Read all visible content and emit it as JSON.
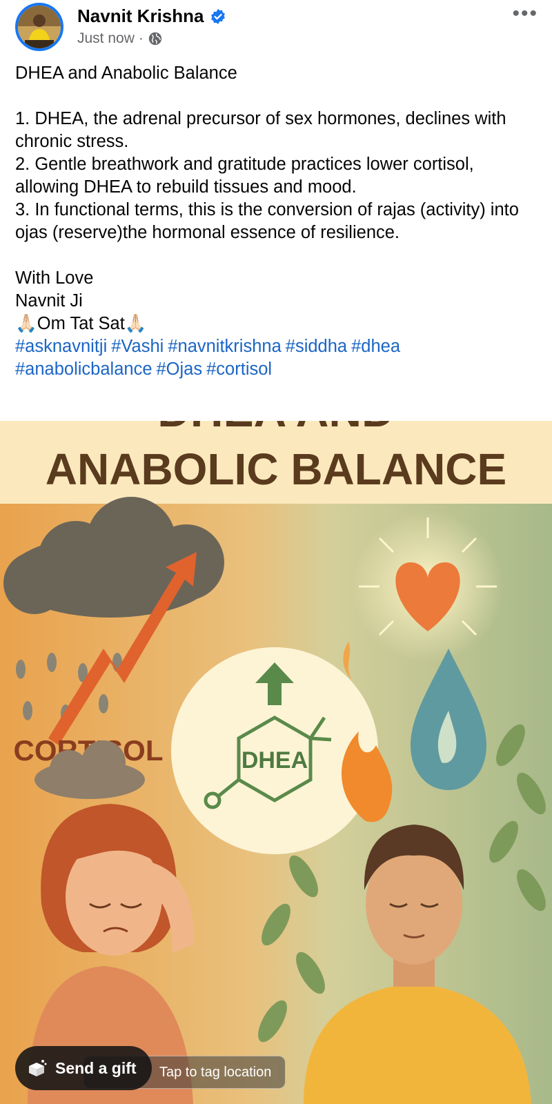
{
  "post": {
    "author": "Navnit Krishna",
    "timestamp": "Just now",
    "separator": "·",
    "privacy_icon": "globe-icon",
    "more_label": "•••",
    "lines": [
      "DHEA and Anabolic Balance",
      "",
      "1. DHEA, the adrenal precursor of sex hormones, declines with chronic stress.",
      "2. Gentle breathwork and gratitude practices lower cortisol, allowing DHEA to rebuild tissues and mood.",
      "3. In functional terms, this is the conversion of rajas (activity) into ojas (reserve)the hormonal essence of resilience.",
      "",
      "With Love",
      "Navnit Ji",
      "🙏🏻Om Tat Sat🙏🏻"
    ],
    "hashtags": [
      "#asknavnitji",
      "#Vashi",
      "#navnitkrishna",
      "#siddha",
      "#dhea",
      "#anabolicbalance",
      "#Ojas",
      "#cortisol"
    ]
  },
  "image": {
    "title_partial": "DHEA AND",
    "title": "ANABOLIC BALANCE",
    "cortisol_label": "CORTISOL",
    "dhea_label": "DHEA"
  },
  "overlay": {
    "gift_label": "Send a gift",
    "tag_label": "Tap to tag location"
  },
  "colors": {
    "accent": "#1877f2",
    "hashtag": "#1b65c5",
    "title_brown": "#5a3b1e",
    "banner_bg": "#fbe9bd"
  }
}
